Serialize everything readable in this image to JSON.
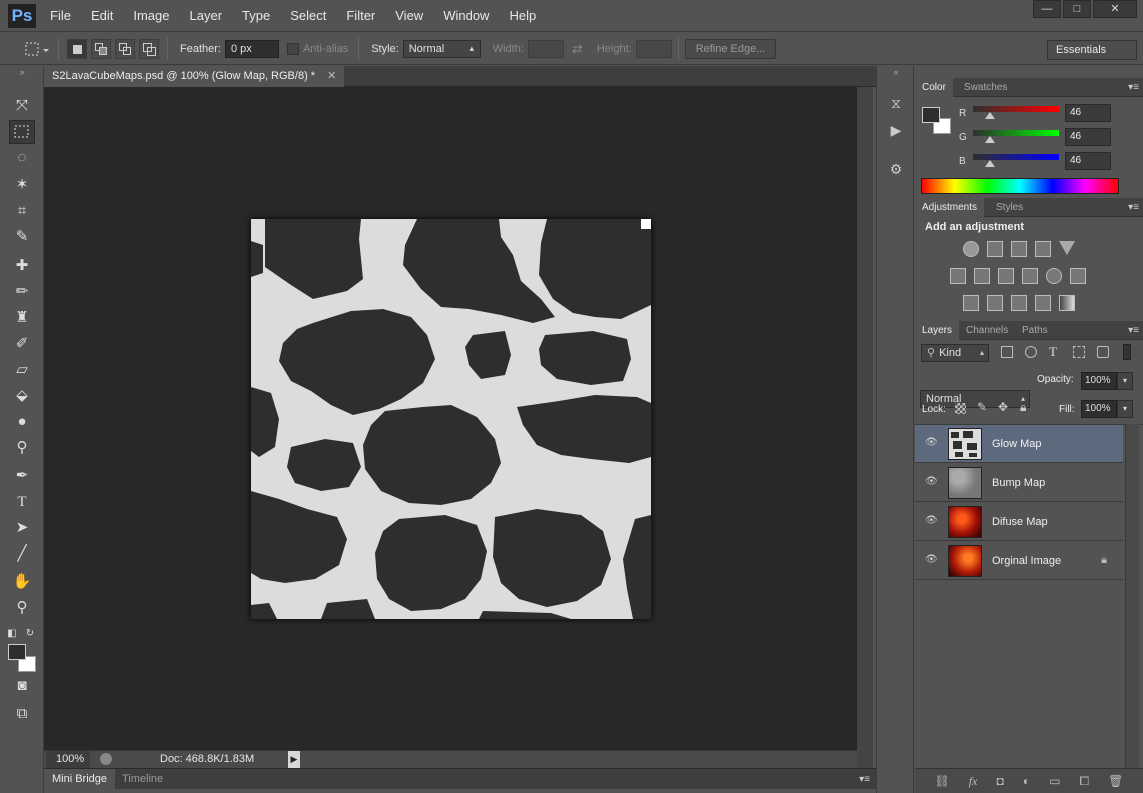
{
  "app": {
    "logo": "Ps"
  },
  "menu": [
    "File",
    "Edit",
    "Image",
    "Layer",
    "Type",
    "Select",
    "Filter",
    "View",
    "Window",
    "Help"
  ],
  "window_controls": {
    "minimize": "—",
    "maximize": "□",
    "close": "✕"
  },
  "options": {
    "feather_label": "Feather:",
    "feather_value": "0 px",
    "antialias_label": "Anti-alias",
    "style_label": "Style:",
    "style_value": "Normal",
    "width_label": "Width:",
    "height_label": "Height:",
    "refine_edge": "Refine Edge...",
    "workspace": "Essentials"
  },
  "document": {
    "tab_title": "S2LavaCubeMaps.psd @ 100% (Glow Map, RGB/8) *",
    "zoom": "100%",
    "doc_info": "Doc: 468.8K/1.83M"
  },
  "bottom_tabs": [
    "Mini Bridge",
    "Timeline"
  ],
  "color_panel": {
    "tabs": [
      "Color",
      "Swatches"
    ],
    "channels": [
      {
        "label": "R",
        "value": "46"
      },
      {
        "label": "G",
        "value": "46"
      },
      {
        "label": "B",
        "value": "46"
      }
    ]
  },
  "adjustments_panel": {
    "tabs": [
      "Adjustments",
      "Styles"
    ],
    "heading": "Add an adjustment"
  },
  "layers_panel": {
    "tabs": [
      "Layers",
      "Channels",
      "Paths"
    ],
    "filter_kind": "Kind",
    "blend_mode": "Normal",
    "opacity_label": "Opacity:",
    "opacity_value": "100%",
    "lock_label": "Lock:",
    "fill_label": "Fill:",
    "fill_value": "100%",
    "layers": [
      {
        "name": "Glow Map",
        "selected": true,
        "locked": false
      },
      {
        "name": "Bump Map",
        "selected": false,
        "locked": false
      },
      {
        "name": "Difuse Map",
        "selected": false,
        "locked": false
      },
      {
        "name": "Orginal Image",
        "selected": false,
        "locked": true
      }
    ]
  },
  "colors": {
    "accent": "#5d6a7d",
    "foreground": "#2e2e2e",
    "background": "#ffffff"
  }
}
